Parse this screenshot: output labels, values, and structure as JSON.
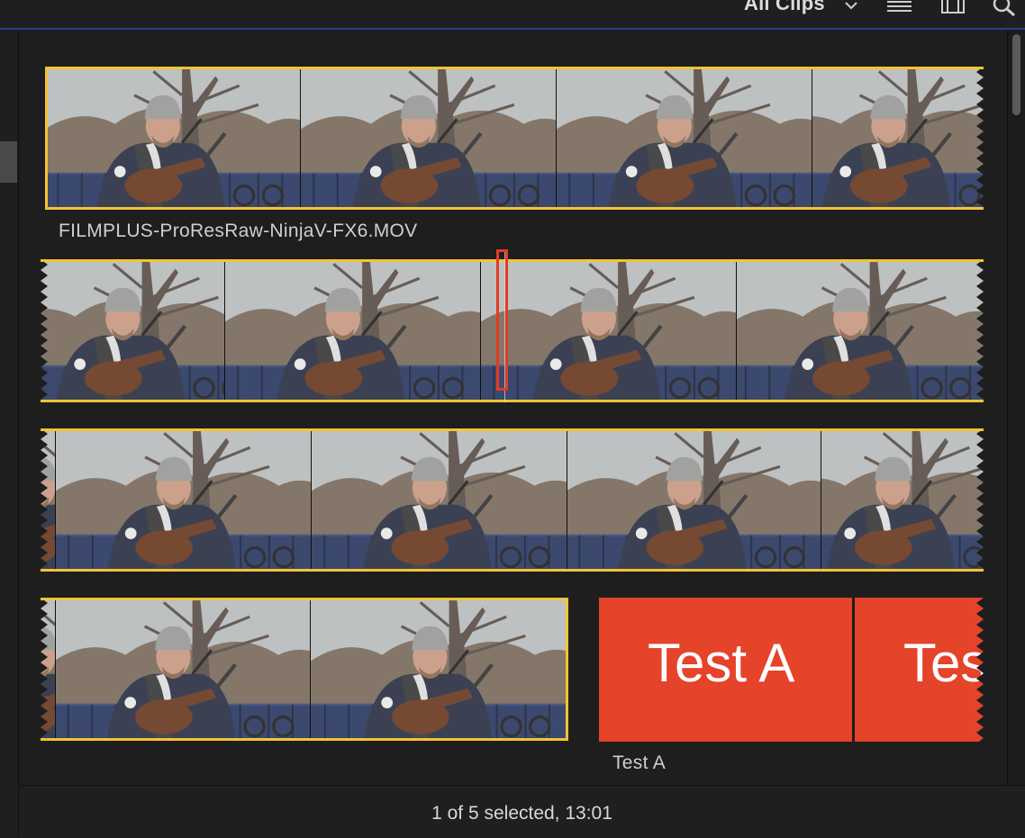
{
  "toolbar": {
    "filter_label": "All Clips",
    "icons": [
      "chevron-down-icon",
      "list-view-icon",
      "filmstrip-view-icon",
      "search-icon"
    ]
  },
  "clips": [
    {
      "name": "FILMPLUS-ProResRaw-NinjaV-FX6.MOV",
      "selected": true
    },
    {
      "name": "",
      "selected": true
    },
    {
      "name": "",
      "selected": true
    },
    {
      "name": "",
      "selected": true
    },
    {
      "name": "Test A",
      "selected": false,
      "title_text": "Test A",
      "title_text_partial": "Tes",
      "color": "#e5432a"
    }
  ],
  "status": {
    "text": "1 of 5 selected, 13:01"
  },
  "colors": {
    "selection": "#f2c335",
    "playhead": "#e23b23",
    "title_clip": "#e5432a"
  }
}
